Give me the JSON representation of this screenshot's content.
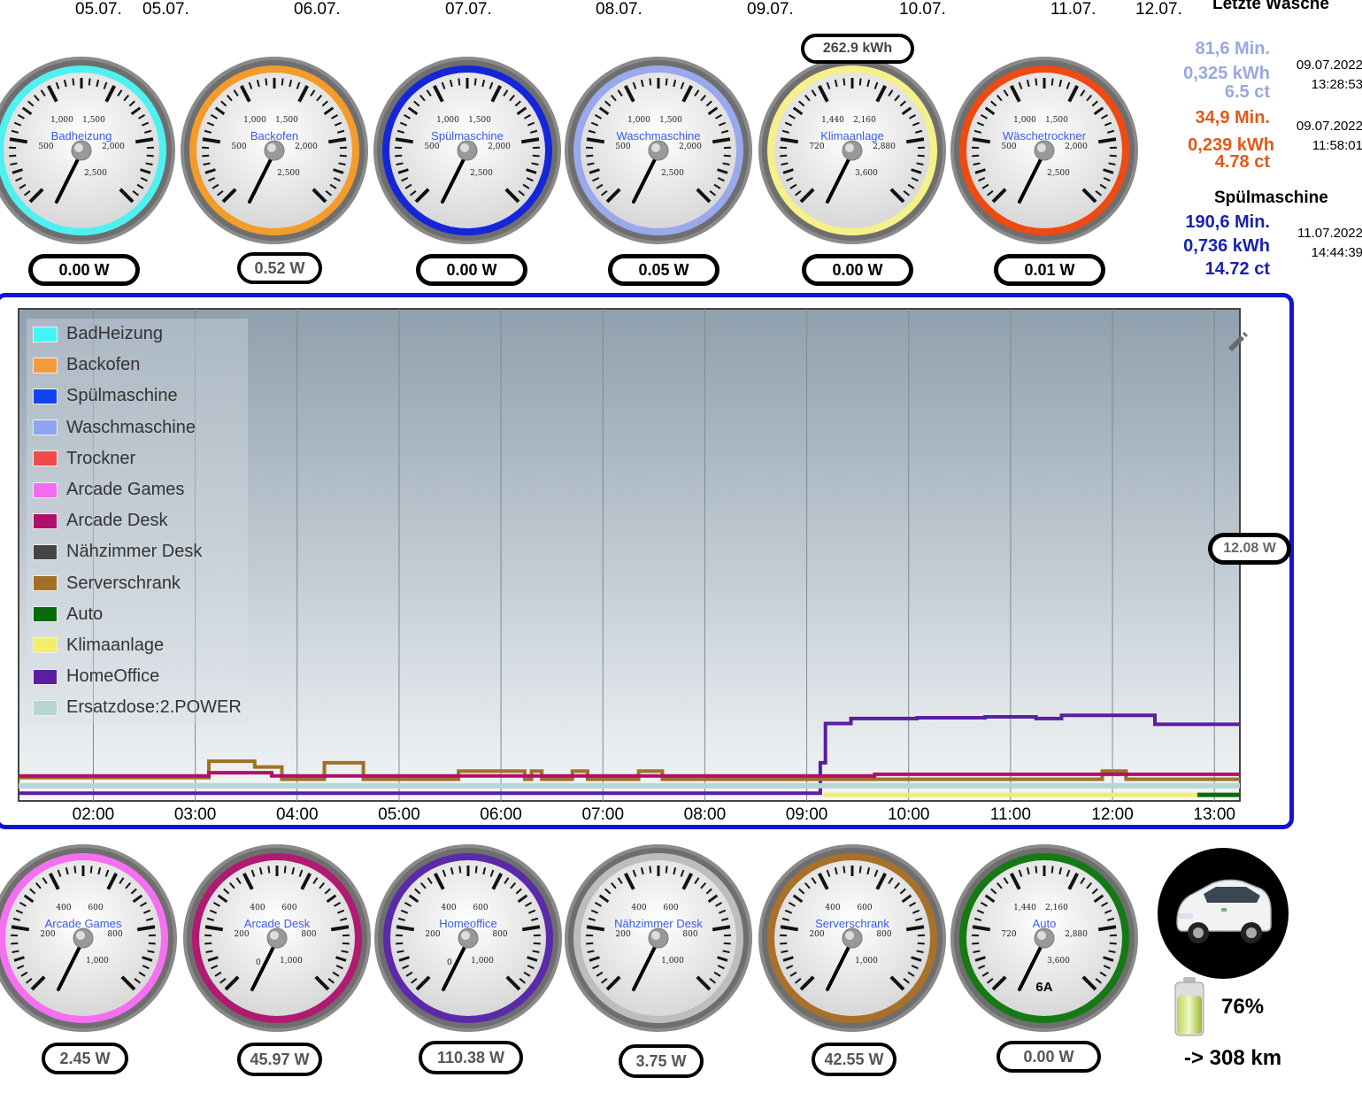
{
  "top_dates": [
    "05.07.",
    "05.07.",
    "06.07.",
    "07.07.",
    "08.07.",
    "09.07.",
    "10.07.",
    "11.07.",
    "12.07."
  ],
  "top_gauges": [
    {
      "label": "Badheizung",
      "ring": "#4ff0f0",
      "ticks": [
        "500",
        "1,000",
        "1,500",
        "2,000",
        "2,500"
      ],
      "power": "0.00 W",
      "gray": false
    },
    {
      "label": "Backofen",
      "ring": "#f39c2a",
      "ticks": [
        "500",
        "1,000",
        "1,500",
        "2,000",
        "2,500"
      ],
      "power": "0.52 W",
      "gray": true
    },
    {
      "label": "Spülmaschine",
      "ring": "#1526d8",
      "ticks": [
        "500",
        "1,000",
        "1,500",
        "2,000",
        "2,500"
      ],
      "power": "0.00 W",
      "gray": false
    },
    {
      "label": "Waschmaschine",
      "ring": "#9aa8ec",
      "ticks": [
        "500",
        "1,000",
        "1,500",
        "2,000",
        "2,500"
      ],
      "power": "0.05 W",
      "gray": false
    },
    {
      "label": "Klimaanlage",
      "ring": "#f5f08a",
      "ticks": [
        "720",
        "1,440",
        "2,160",
        "2,880",
        "3,600"
      ],
      "power": "0.00 W",
      "gray": false,
      "extra": "262.9 kWh"
    },
    {
      "label": "Wäschetrockner",
      "ring": "#ee4a12",
      "ticks": [
        "500",
        "1,000",
        "1,500",
        "2,000",
        "2,500"
      ],
      "power": "0.01 W",
      "gray": false
    }
  ],
  "bottom_gauges": [
    {
      "label": "Arcade Games",
      "ring": "#f470f0",
      "ticks": [
        "200",
        "400",
        "600",
        "800",
        "1,000"
      ],
      "power": "2.45 W",
      "gray": true
    },
    {
      "label": "Arcade Desk",
      "ring": "#b01a70",
      "ticks": [
        "200",
        "400",
        "600",
        "800",
        "1,000"
      ],
      "power": "45.97 W",
      "gray": true,
      "zero": "0"
    },
    {
      "label": "Homeoffice",
      "ring": "#5a2aa8",
      "ticks": [
        "200",
        "400",
        "600",
        "800",
        "1,000"
      ],
      "power": "110.38 W",
      "gray": true,
      "zero": "0"
    },
    {
      "label": "Nähzimmer Desk",
      "ring": "#bdbdbd",
      "ticks": [
        "200",
        "400",
        "600",
        "800",
        "1,000"
      ],
      "power": "3.75 W",
      "gray": true
    },
    {
      "label": "Serverschrank",
      "ring": "#a8712a",
      "ticks": [
        "200",
        "400",
        "600",
        "800",
        "1,000"
      ],
      "power": "42.55 W",
      "gray": true
    },
    {
      "label": "Auto",
      "ring": "#157a15",
      "ticks": [
        "720",
        "1,440",
        "2,160",
        "2,880",
        "3,600"
      ],
      "power": "0.00 W",
      "gray": true,
      "extra": "6A"
    }
  ],
  "side": {
    "title_top": "Letzte Wäsche",
    "wash": {
      "minutes": "81,6 Min.",
      "kwh": "0,325 kWh",
      "cost": "6.5 ct",
      "date": "09.07.2022",
      "time": "13:28:53",
      "color": "#9aa8e0"
    },
    "dryer": {
      "minutes": "34,9 Min.",
      "kwh": "0,239 kWh",
      "cost": "4.78 ct",
      "date": "09.07.2022",
      "time": "11:58:01",
      "color": "#e05a1a"
    },
    "dish_title": "Spülmaschine",
    "dish": {
      "minutes": "190,6 Min.",
      "kwh": "0,736 kWh",
      "cost": "14.72 ct",
      "date": "11.07.2022",
      "time": "14:44:39",
      "color": "#1a22b0"
    }
  },
  "chart_data": {
    "type": "line",
    "x_ticks": [
      "02:00",
      "03:00",
      "04:00",
      "05:00",
      "06:00",
      "07:00",
      "08:00",
      "09:00",
      "10:00",
      "11:00",
      "12:00",
      "13:00"
    ],
    "x_range": [
      "01:16",
      "13:15"
    ],
    "current_value": "12.08 W",
    "legend": [
      {
        "name": "BadHeizung",
        "color": "#44f5f5"
      },
      {
        "name": "Backofen",
        "color": "#f59a3c"
      },
      {
        "name": "Spülmaschine",
        "color": "#1144ee"
      },
      {
        "name": "Waschmaschine",
        "color": "#8ea4ee"
      },
      {
        "name": "Trockner",
        "color": "#f04a4a"
      },
      {
        "name": "Arcade Games",
        "color": "#f56af0"
      },
      {
        "name": "Arcade Desk",
        "color": "#b0106a"
      },
      {
        "name": "Nähzimmer Desk",
        "color": "#454545"
      },
      {
        "name": "Serverschrank",
        "color": "#a0702a"
      },
      {
        "name": "Auto",
        "color": "#0a6a0a"
      },
      {
        "name": "Klimaanlage",
        "color": "#f0ee6a"
      },
      {
        "name": "HomeOffice",
        "color": "#5a1ea0"
      },
      {
        "name": "Ersatzdose:2.POWER",
        "color": "#b8d6d2"
      }
    ],
    "series": [
      {
        "name": "HomeOffice",
        "points": [
          [
            "01:16",
            3
          ],
          [
            "09:08",
            3
          ],
          [
            "09:08",
            40
          ],
          [
            "09:11",
            40
          ],
          [
            "09:11",
            88
          ],
          [
            "09:26",
            88
          ],
          [
            "09:26",
            94
          ],
          [
            "10:05",
            94
          ],
          [
            "10:05",
            95
          ],
          [
            "10:45",
            95
          ],
          [
            "10:45",
            96
          ],
          [
            "11:15",
            96
          ],
          [
            "11:15",
            94
          ],
          [
            "11:30",
            94
          ],
          [
            "11:30",
            98
          ],
          [
            "12:25",
            98
          ],
          [
            "12:25",
            87
          ],
          [
            "13:15",
            87
          ]
        ]
      },
      {
        "name": "Serverschrank",
        "points": [
          [
            "01:16",
            22
          ],
          [
            "03:08",
            22
          ],
          [
            "03:08",
            42
          ],
          [
            "03:35",
            42
          ],
          [
            "03:35",
            35
          ],
          [
            "03:51",
            35
          ],
          [
            "03:51",
            20
          ],
          [
            "04:16",
            20
          ],
          [
            "04:16",
            40
          ],
          [
            "04:39",
            40
          ],
          [
            "04:39",
            20
          ],
          [
            "05:35",
            20
          ],
          [
            "05:35",
            30
          ],
          [
            "06:14",
            30
          ],
          [
            "06:14",
            20
          ],
          [
            "06:18",
            20
          ],
          [
            "06:18",
            30
          ],
          [
            "06:24",
            30
          ],
          [
            "06:24",
            20
          ],
          [
            "06:42",
            20
          ],
          [
            "06:42",
            30
          ],
          [
            "06:51",
            30
          ],
          [
            "06:51",
            20
          ],
          [
            "07:21",
            20
          ],
          [
            "07:21",
            30
          ],
          [
            "07:35",
            30
          ],
          [
            "07:35",
            20
          ],
          [
            "11:54",
            20
          ],
          [
            "11:54",
            30
          ],
          [
            "12:08",
            30
          ],
          [
            "12:08",
            20
          ],
          [
            "13:15",
            20
          ]
        ]
      },
      {
        "name": "Arcade Desk",
        "points": [
          [
            "01:16",
            24
          ],
          [
            "03:08",
            24
          ],
          [
            "03:08",
            28
          ],
          [
            "03:45",
            28
          ],
          [
            "03:45",
            24
          ],
          [
            "09:40",
            24
          ],
          [
            "09:40",
            26
          ],
          [
            "13:15",
            26
          ]
        ]
      },
      {
        "name": "Ersatzdose:2.POWER",
        "points": [
          [
            "01:16",
            12
          ],
          [
            "13:15",
            12
          ]
        ]
      },
      {
        "name": "Klimaanlage",
        "points": [
          [
            "09:10",
            1
          ],
          [
            "12:50",
            1
          ]
        ]
      },
      {
        "name": "Auto",
        "points": [
          [
            "12:50",
            1
          ],
          [
            "13:15",
            1
          ]
        ]
      }
    ]
  }
}
